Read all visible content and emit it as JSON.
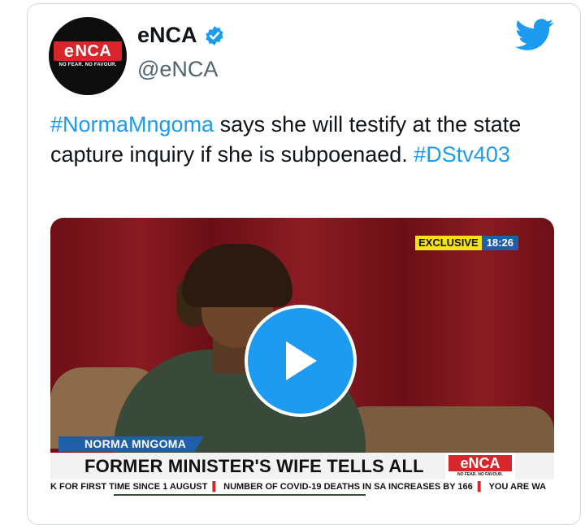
{
  "tweet": {
    "display_name": "eNCA",
    "handle": "@eNCA",
    "text_parts": [
      {
        "text": "#NormaMngoma",
        "hashtag": true
      },
      {
        "text": " says she will testify at the state capture inquiry if she is subpoenaed. ",
        "hashtag": false
      },
      {
        "text": "#DStv403",
        "hashtag": true
      }
    ]
  },
  "avatar_logo": {
    "text": "NCA",
    "letter": "e",
    "tagline": "NO FEAR. NO FAVOUR."
  },
  "icons": {
    "verified": "verified-badge-icon",
    "twitter": "twitter-bird-icon",
    "play": "play-icon"
  },
  "colors": {
    "twitter_blue": "#1d9bf0",
    "enca_red": "#d7262c",
    "lower_third_blue": "#1f5fa8",
    "exclusive_yellow": "#f7e11b"
  },
  "video": {
    "exclusive_label": "EXCLUSIVE",
    "time": "18:26",
    "lower_third_name": "NORMA MNGOMA",
    "headline": "FORMER MINISTER'S WIFE TELLS ALL",
    "logo_letter": "e",
    "logo_text": "NCA",
    "logo_tagline": "NO FEAR. NO FAVOUR.",
    "ticker": [
      "K FOR FIRST TIME SINCE 1 AUGUST",
      "NUMBER OF COVID-19 DEATHS IN SA INCREASES BY 166",
      "YOU ARE WA"
    ]
  }
}
